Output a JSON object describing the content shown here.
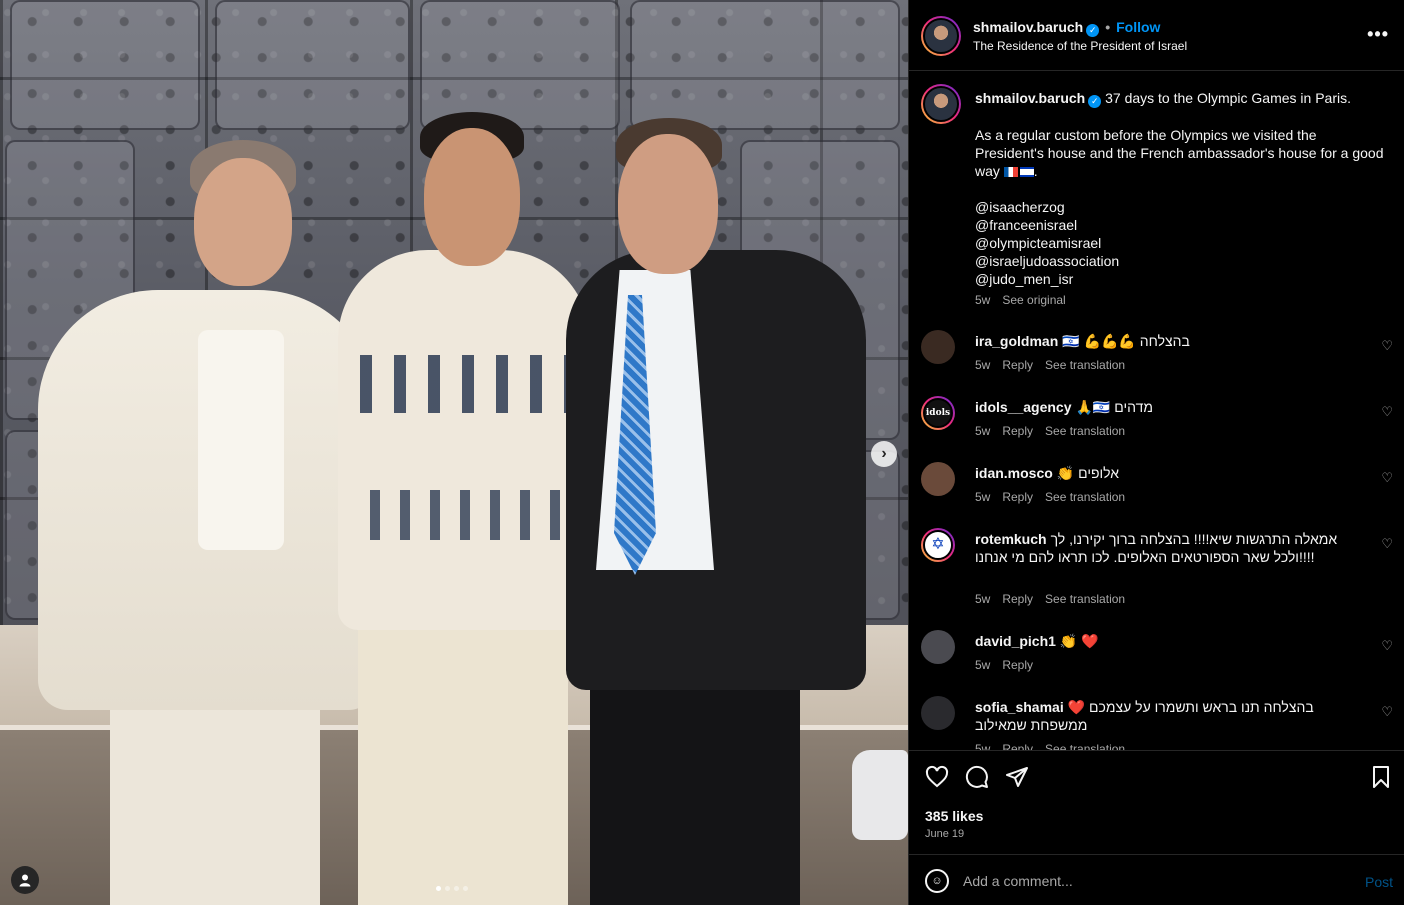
{
  "post": {
    "username": "shmailov.baruch",
    "follow_label": "Follow",
    "separator": "•",
    "location": "The Residence of the President of Israel",
    "more_label": "•••",
    "photo_next": "›"
  },
  "caption": {
    "username": "shmailov.baruch",
    "line1": "37 days to the Olympic Games in Paris.",
    "line2": "As a regular custom before the Olympics we visited the President's house and the French ambassador's house for a good way",
    "line2_end": ".",
    "tags": [
      "@isaacherzog",
      "@franceenisrael",
      "@olympicteamisrael",
      "@israeljudoassociation",
      "@judo_men_isr"
    ],
    "age": "5w",
    "see_original": "See original"
  },
  "comments": [
    {
      "username": "ira_goldman",
      "text": "🇮🇱 💪💪💪 בהצלחה",
      "age": "5w",
      "reply": "Reply",
      "translate": "See translation",
      "avatar_color": "#3a2a22"
    },
    {
      "username": "idols__agency",
      "text": "🙏🇮🇱 מדהים",
      "age": "5w",
      "reply": "Reply",
      "translate": "See translation",
      "avatar_label": "idols",
      "avatar_color": "#1a1a1a"
    },
    {
      "username": "idan.mosco",
      "text": "👏 אלופים",
      "age": "5w",
      "reply": "Reply",
      "translate": "See translation",
      "avatar_color": "#6a4a3a"
    },
    {
      "username": "rotemkuch",
      "text": "אמאלה התרגשות שיא!!!! בהצלחה ברוך יקירנו, לך ולכל שאר הספורטאים האלופים. לכו תראו להם מי אנחנו!!!!",
      "age": "5w",
      "reply": "Reply",
      "translate": "See translation",
      "avatar_label": "✡",
      "avatar_color": "#ffffff"
    },
    {
      "username": "david_pich1",
      "text": "👏 ❤️",
      "age": "5w",
      "reply": "Reply",
      "translate": "",
      "avatar_color": "#4a4a50"
    },
    {
      "username": "sofia_shamai",
      "text": "❤️ בהצלחה תנו בראש ותשמרו על עצמכם ממשפחת שמאילוב",
      "age": "5w",
      "reply": "Reply",
      "translate": "See translation",
      "avatar_color": "#2a2a2e"
    }
  ],
  "actions": {
    "likes": "385 likes",
    "date": "June 19"
  },
  "add_comment": {
    "placeholder": "Add a comment...",
    "post_label": "Post"
  },
  "colors": {
    "accent": "#0095f6",
    "background": "#000000",
    "secondary_text": "#a8a8a8",
    "like_red": "#ff3040"
  }
}
